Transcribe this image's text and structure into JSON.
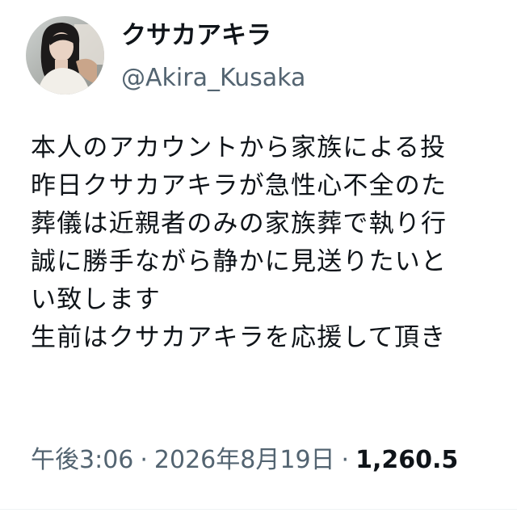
{
  "author": {
    "display_name": "クサカアキラ",
    "handle": "@Akira_Kusaka",
    "avatar_icon": "profile-photo-icon"
  },
  "tweet": {
    "lines": [
      "本人のアカウントから家族による投",
      "昨日クサカアキラが急性心不全のた",
      "葬儀は近親者のみの家族葬で執り行",
      "誠に勝手ながら静かに見送りたいと",
      "い致します",
      "生前はクサカアキラを応援して頂き"
    ]
  },
  "meta": {
    "time": "午後3:06",
    "separator": "·",
    "date": "2026年8月19日",
    "views": "1,260.5"
  },
  "colors": {
    "text_primary": "#0f1419",
    "text_secondary": "#536471",
    "background": "#ffffff"
  }
}
